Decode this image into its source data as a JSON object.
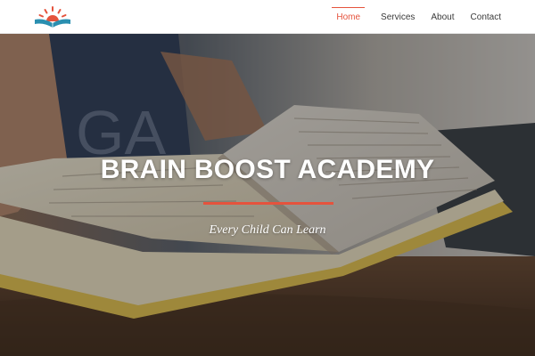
{
  "header": {
    "logo_icon": "rising-sun-open-book-logo",
    "nav": [
      {
        "label": "Home",
        "active": true
      },
      {
        "label": "Services",
        "active": false
      },
      {
        "label": "About",
        "active": false
      },
      {
        "label": "Contact",
        "active": false
      }
    ]
  },
  "hero": {
    "title": "BRAIN BOOST ACADEMY",
    "subtitle": "Every Child Can Learn",
    "background_image": "open-book-on-wooden-table-photo"
  },
  "colors": {
    "accent": "#e5533d",
    "logo_blue": "#2a8fb0",
    "nav_text": "#3a3a3a",
    "header_bg": "#ffffff"
  }
}
